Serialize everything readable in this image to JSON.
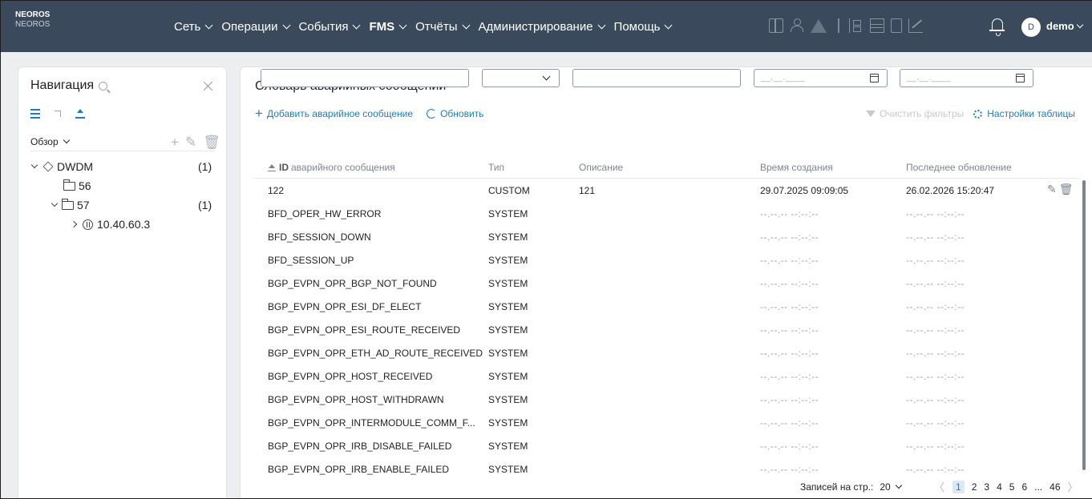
{
  "app": {
    "brand_line1": "NEOROS",
    "brand_line2": "NEOROS"
  },
  "menu": [
    {
      "label": "Сеть"
    },
    {
      "label": "Операции"
    },
    {
      "label": "События"
    },
    {
      "label": "FMS"
    },
    {
      "label": "Отчёты"
    },
    {
      "label": "Администрирование"
    },
    {
      "label": "Помощь"
    }
  ],
  "user": {
    "initial": "D",
    "name": "demo"
  },
  "icons": [
    "grid-icon",
    "users-icon",
    "warning-icon",
    "tree-icon",
    "list-icon",
    "document-icon",
    "chart-icon",
    "bell-icon"
  ],
  "nav": {
    "title": "Навигация",
    "view_select": "Обзор",
    "tree": [
      {
        "label": "DWDM",
        "count": "(1)"
      },
      {
        "label": "56"
      },
      {
        "label": "57",
        "count": "(1)"
      },
      {
        "label": "10.40.60.3"
      }
    ]
  },
  "main": {
    "title": "Словарь аварийных сообщений",
    "add_label": "Добавить аварийное сообщение",
    "refresh_label": "Обновить",
    "clear_filters": "Очистить фильтры",
    "table_settings": "Настройки таблицы",
    "date_placeholder": "__.__.____",
    "columns": {
      "id_prefix": "ID",
      "id": "аварийного сообщения",
      "type": "Тип",
      "description": "Описание",
      "created": "Время создания",
      "updated": "Последнее обновление"
    },
    "rows": [
      {
        "id": "122",
        "type": "CUSTOM",
        "desc": "121",
        "created": "29.07.2025 09:09:05",
        "updated": "26.02.2026 15:20:47"
      },
      {
        "id": "BFD_OPER_HW_ERROR",
        "type": "SYSTEM",
        "desc": "",
        "created": "--.--.-- --:--:--",
        "updated": "--.--.-- --:--:--"
      },
      {
        "id": "BFD_SESSION_DOWN",
        "type": "SYSTEM",
        "desc": "",
        "created": "--.--.-- --:--:--",
        "updated": "--.--.-- --:--:--"
      },
      {
        "id": "BFD_SESSION_UP",
        "type": "SYSTEM",
        "desc": "",
        "created": "--.--.-- --:--:--",
        "updated": "--.--.-- --:--:--"
      },
      {
        "id": "BGP_EVPN_OPR_BGP_NOT_FOUND",
        "type": "SYSTEM",
        "desc": "",
        "created": "--.--.-- --:--:--",
        "updated": "--.--.-- --:--:--"
      },
      {
        "id": "BGP_EVPN_OPR_ESI_DF_ELECT",
        "type": "SYSTEM",
        "desc": "",
        "created": "--.--.-- --:--:--",
        "updated": "--.--.-- --:--:--"
      },
      {
        "id": "BGP_EVPN_OPR_ESI_ROUTE_RECEIVED",
        "type": "SYSTEM",
        "desc": "",
        "created": "--.--.-- --:--:--",
        "updated": "--.--.-- --:--:--"
      },
      {
        "id": "BGP_EVPN_OPR_ETH_AD_ROUTE_RECEIVED",
        "type": "SYSTEM",
        "desc": "",
        "created": "--.--.-- --:--:--",
        "updated": "--.--.-- --:--:--"
      },
      {
        "id": "BGP_EVPN_OPR_HOST_RECEIVED",
        "type": "SYSTEM",
        "desc": "",
        "created": "--.--.-- --:--:--",
        "updated": "--.--.-- --:--:--"
      },
      {
        "id": "BGP_EVPN_OPR_HOST_WITHDRAWN",
        "type": "SYSTEM",
        "desc": "",
        "created": "--.--.-- --:--:--",
        "updated": "--.--.-- --:--:--"
      },
      {
        "id": "BGP_EVPN_OPR_INTERMODULE_COMM_F...",
        "type": "SYSTEM",
        "desc": "",
        "created": "--.--.-- --:--:--",
        "updated": "--.--.-- --:--:--"
      },
      {
        "id": "BGP_EVPN_OPR_IRB_DISABLE_FAILED",
        "type": "SYSTEM",
        "desc": "",
        "created": "--.--.-- --:--:--",
        "updated": "--.--.-- --:--:--"
      },
      {
        "id": "BGP_EVPN_OPR_IRB_ENABLE_FAILED",
        "type": "SYSTEM",
        "desc": "",
        "created": "--.--.-- --:--:--",
        "updated": "--.--.-- --:--:--"
      }
    ],
    "pager": {
      "per_page_label": "Записей на стр.:",
      "per_page": "20",
      "pages": [
        "1",
        "2",
        "3",
        "4",
        "5",
        "6",
        "...",
        "46"
      ],
      "current": "1"
    }
  },
  "colors": {
    "topbar": "#3a4a5c",
    "accent": "#1f7bbf",
    "workspace": "#eceef0"
  }
}
